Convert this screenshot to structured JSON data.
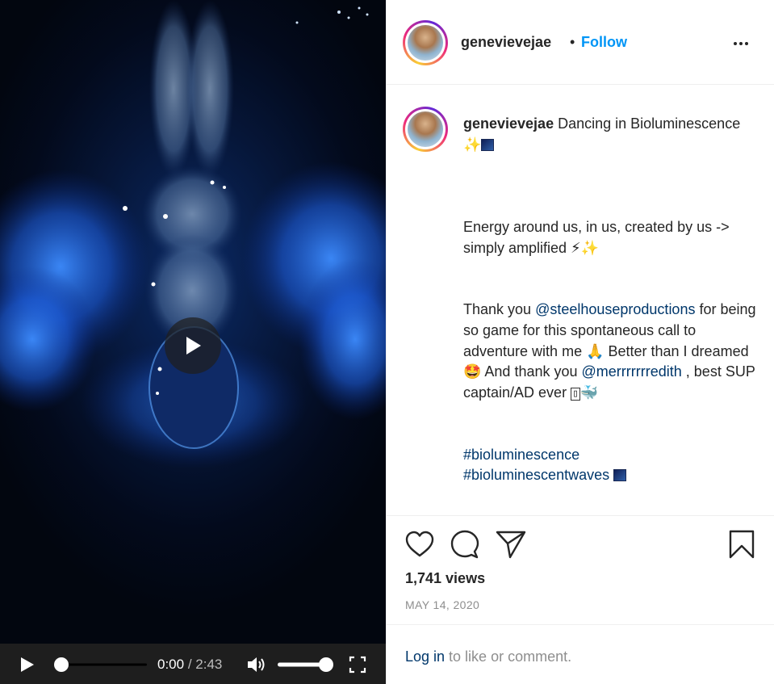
{
  "post": {
    "username": "genevievejae",
    "dot": "•",
    "follow_label": "Follow",
    "more_icon": "more-horizontal-icon"
  },
  "caption": {
    "username": "genevievejae",
    "line1_text": " Dancing in Bioluminescence ✨",
    "para2": "Energy around us, in us, created by us -> simply amplified ⚡✨",
    "para3_a": "Thank you ",
    "mention1": "@steelhouseproductions",
    "para3_b": " for being so game for this spontaneous call to adventure with me 🙏 Better than I dreamed 🤩 And thank you ",
    "mention2": "@merrrrrrredith",
    "para3_c": " , best SUP captain/AD ever ",
    "para3_sq": "01F\n910",
    "para3_d": "🐳",
    "hashtag1": "#bioluminescence",
    "hashtag2": "#bioluminescentwaves"
  },
  "stats": {
    "views": "1,741 views",
    "date": "MAY 14, 2020"
  },
  "footer": {
    "login_link": "Log in",
    "login_rest": " to like or comment."
  },
  "video": {
    "current_time": "0:00",
    "separator": " / ",
    "duration": "2:43",
    "progress": 0,
    "volume": 1.0
  },
  "colors": {
    "accent": "#0095f6",
    "link": "#00376b",
    "muted": "#8e8e8e",
    "text": "#262626"
  }
}
